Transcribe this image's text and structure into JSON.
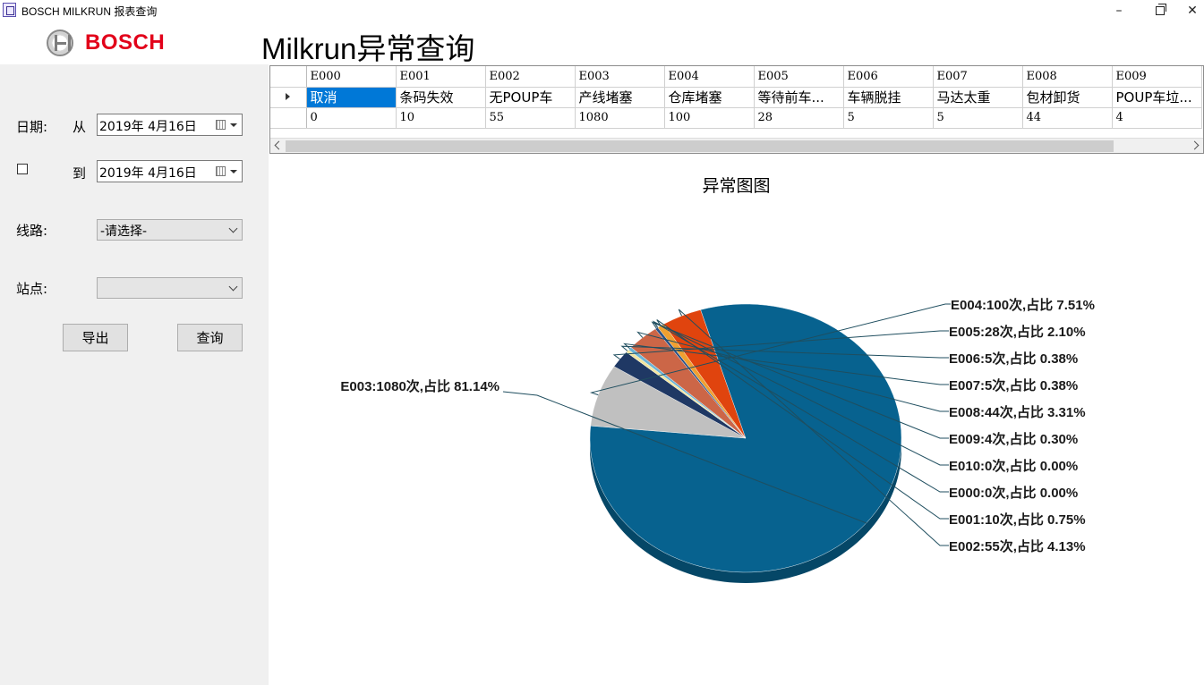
{
  "window": {
    "title": "BOSCH MILKRUN 报表查询",
    "minimize": "–",
    "close": "✕"
  },
  "brand": {
    "name": "BOSCH"
  },
  "page_title": "Milkrun异常查询",
  "filters": {
    "date_label": "日期:",
    "from_label": "从",
    "to_label": "到",
    "from_date": "2019年  4月16日",
    "to_date": "2019年  4月16日",
    "line_label": "线路:",
    "line_value": "-请选择-",
    "station_label": "站点:",
    "station_value": "",
    "export_label": "导出",
    "query_label": "查询"
  },
  "grid": {
    "columns": [
      "E000",
      "E001",
      "E002",
      "E003",
      "E004",
      "E005",
      "E006",
      "E007",
      "E008",
      "E009"
    ],
    "names": [
      "取消",
      "条码失效",
      "无POUP车",
      "产线堵塞",
      "仓库堵塞",
      "等待前车...",
      "车辆脱挂",
      "马达太重",
      "包材卸货",
      "POUP车垃..."
    ],
    "counts": [
      "0",
      "10",
      "55",
      "1080",
      "100",
      "28",
      "5",
      "5",
      "44",
      "4"
    ],
    "selected_cell": "E000"
  },
  "chart_data": {
    "type": "pie",
    "title": "异常图图",
    "slices": [
      {
        "code": "E000",
        "count": 0,
        "percent": 0.0,
        "label": "E000:0次,占比 0.00%",
        "color": "#3a6fb0"
      },
      {
        "code": "E001",
        "count": 10,
        "percent": 0.75,
        "label": "E001:10次,占比 0.75%",
        "color": "#f0a030"
      },
      {
        "code": "E002",
        "count": 55,
        "percent": 4.13,
        "label": "E002:55次,占比 4.13%",
        "color": "#e0440e"
      },
      {
        "code": "E003",
        "count": 1080,
        "percent": 81.14,
        "label": "E003:1080次,占比 81.14%",
        "color": "#07628f"
      },
      {
        "code": "E004",
        "count": 100,
        "percent": 7.51,
        "label": "E004:100次,占比 7.51%",
        "color": "#c0c0c0"
      },
      {
        "code": "E005",
        "count": 28,
        "percent": 2.1,
        "label": "E005:28次,占比 2.10%",
        "color": "#1f3864"
      },
      {
        "code": "E006",
        "count": 5,
        "percent": 0.38,
        "label": "E006:5次,占比 0.38%",
        "color": "#f3e6a0"
      },
      {
        "code": "E007",
        "count": 5,
        "percent": 0.38,
        "label": "E007:5次,占比 0.38%",
        "color": "#6bb4d6"
      },
      {
        "code": "E008",
        "count": 44,
        "percent": 3.31,
        "label": "E008:44次,占比 3.31%",
        "color": "#cc6647"
      },
      {
        "code": "E009",
        "count": 4,
        "percent": 0.3,
        "label": "E009:4次,占比 0.30%",
        "color": "#2a4f84"
      },
      {
        "code": "E010",
        "count": 0,
        "percent": 0.0,
        "label": "E010:0次,占比 0.00%",
        "color": "#7f7f7f"
      }
    ]
  }
}
